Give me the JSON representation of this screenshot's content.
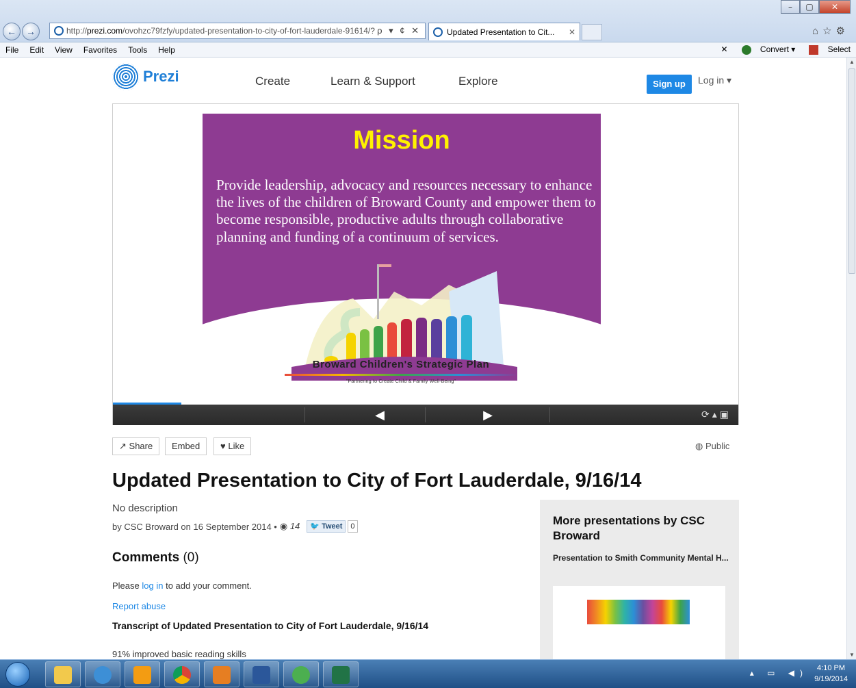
{
  "browser": {
    "url_prefix": "http://",
    "url_host": "prezi.com",
    "url_path": "/ovohzc79fzfy/updated-presentation-to-city-of-fort-lauderdale-91614/?",
    "addr_tools": "ρ ▾ ¢ ✕",
    "tab_title": "Updated Presentation to Cit...",
    "tab_close": "✕",
    "menu": [
      "File",
      "Edit",
      "View",
      "Favorites",
      "Tools",
      "Help"
    ],
    "convert_label": "Convert",
    "select_label": "Select",
    "toolbar_close": "✕"
  },
  "site": {
    "brand": "Prezi",
    "nav": [
      "Create",
      "Learn & Support",
      "Explore"
    ],
    "signup": "Sign up",
    "login": "Log in ▾"
  },
  "slide": {
    "heading": "Mission",
    "body": "Provide leadership, advocacy and resources necessary to enhance the lives of the children of Broward County and empower them to become responsible, productive adults through collaborative planning and funding of a continuum of services.",
    "logo_title": "Broward Children's Strategic Plan",
    "logo_subtitle": "\"Partnering to Create Child & Family Well-Being\""
  },
  "actions": {
    "share": "Share",
    "embed": "Embed",
    "like": "Like",
    "visibility": "Public"
  },
  "presentation": {
    "title": "Updated Presentation to City of Fort Lauderdale, 9/16/14",
    "description": "No description",
    "byline": "by CSC Broward on 16 September 2014 •",
    "views": "14",
    "tweet": "Tweet",
    "tweet_count": "0"
  },
  "comments": {
    "heading": "Comments",
    "count": "(0)",
    "prefix": "Please",
    "link": "log in",
    "suffix": "to add your comment.",
    "report": "Report abuse"
  },
  "transcript": {
    "heading": "Transcript of Updated Presentation to City of Fort Lauderdale, 9/16/14",
    "first_line": "91% improved basic reading skills"
  },
  "sidebar": {
    "heading": "More presentations by CSC Broward",
    "item_title": "Presentation to Smith Community Mental H..."
  },
  "clock": {
    "time": "4:10 PM",
    "date": "9/19/2014"
  },
  "colors": {
    "accent": "#1e88e5",
    "slide_bg": "#8e3b92",
    "mission": "#fff200"
  }
}
